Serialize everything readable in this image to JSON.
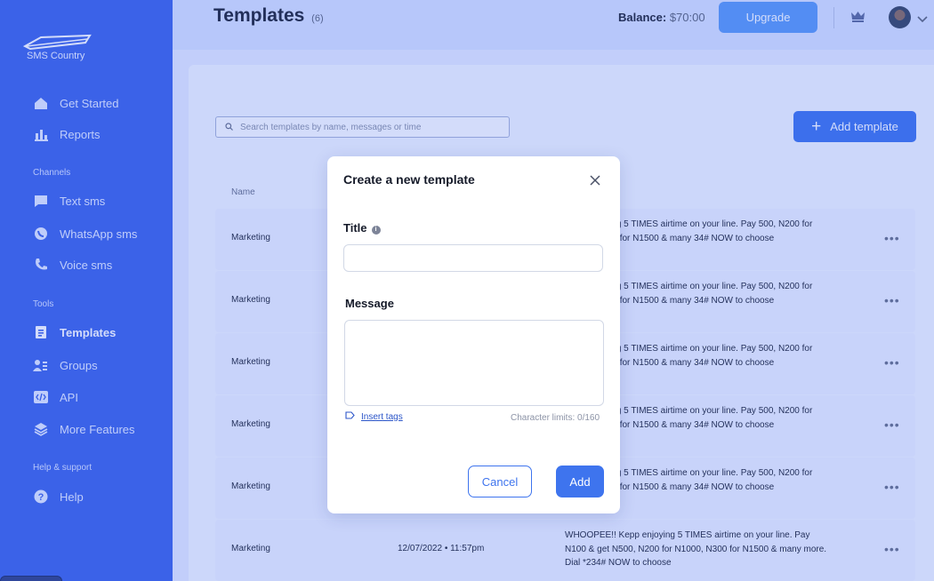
{
  "app": {
    "logo_text": "SMS Country"
  },
  "sidebar": {
    "items": [
      {
        "label": "Get Started",
        "icon": "home-icon"
      },
      {
        "label": "Reports",
        "icon": "bar-chart-icon"
      }
    ],
    "channels_label": "Channels",
    "channels": [
      {
        "label": "Text sms",
        "icon": "chat-icon"
      },
      {
        "label": "WhatsApp sms",
        "icon": "whatsapp-icon"
      },
      {
        "label": "Voice sms",
        "icon": "phone-icon"
      }
    ],
    "tools_label": "Tools",
    "tools": [
      {
        "label": "Templates",
        "icon": "document-icon",
        "active": true
      },
      {
        "label": "Groups",
        "icon": "users-icon"
      },
      {
        "label": "API",
        "icon": "code-icon"
      },
      {
        "label": "More Features",
        "icon": "layers-icon"
      }
    ],
    "support_label": "Help & support",
    "support": [
      {
        "label": "Help",
        "icon": "help-circle-icon"
      }
    ]
  },
  "header": {
    "title": "Templates",
    "count": "(6)",
    "balance_label": "Balance:",
    "balance_value": "$70:00",
    "upgrade_label": "Upgrade"
  },
  "main": {
    "search_placeholder": "Search templates by name, messages or time",
    "add_template_label": "Add template",
    "column_name": "Name",
    "rows": [
      {
        "category": "Marketing",
        "date": "",
        "message": "Kepp enjoying 5 TIMES airtime on your line. Pay 500, N200 for N1000, N300 for N1500 & many 34# NOW to choose"
      },
      {
        "category": "Marketing",
        "date": "",
        "message": "Kepp enjoying 5 TIMES airtime on your line. Pay 500, N200 for N1000, N300 for N1500 & many 34# NOW to choose"
      },
      {
        "category": "Marketing",
        "date": "",
        "message": "Kepp enjoying 5 TIMES airtime on your line. Pay 500, N200 for N1000, N300 for N1500 & many 34# NOW to choose"
      },
      {
        "category": "Marketing",
        "date": "",
        "message": "Kepp enjoying 5 TIMES airtime on your line. Pay 500, N200 for N1000, N300 for N1500 & many 34# NOW to choose"
      },
      {
        "category": "Marketing",
        "date": "",
        "message": "Kepp enjoying 5 TIMES airtime on your line. Pay 500, N200 for N1000, N300 for N1500 & many 34# NOW to choose"
      },
      {
        "category": "Marketing",
        "date": "12/07/2022 • 11:57pm",
        "message": "WHOOPEE!! Kepp enjoying 5 TIMES airtime on your line. Pay N100 & get N500, N200 for N1000, N300 for N1500 & many more. Dial *234# NOW to choose"
      }
    ],
    "more_label": "•••"
  },
  "modal": {
    "title": "Create a new template",
    "title_field_label": "Title",
    "message_field_label": "Message",
    "title_value": "",
    "message_value": "",
    "insert_tags_label": "Insert tags",
    "char_limit": "Character limits: 0/160",
    "cancel_label": "Cancel",
    "add_label": "Add"
  },
  "colors": {
    "sidebar": "#3d63e8",
    "primary": "#3e74ee",
    "upgrade": "#5b9af6"
  }
}
